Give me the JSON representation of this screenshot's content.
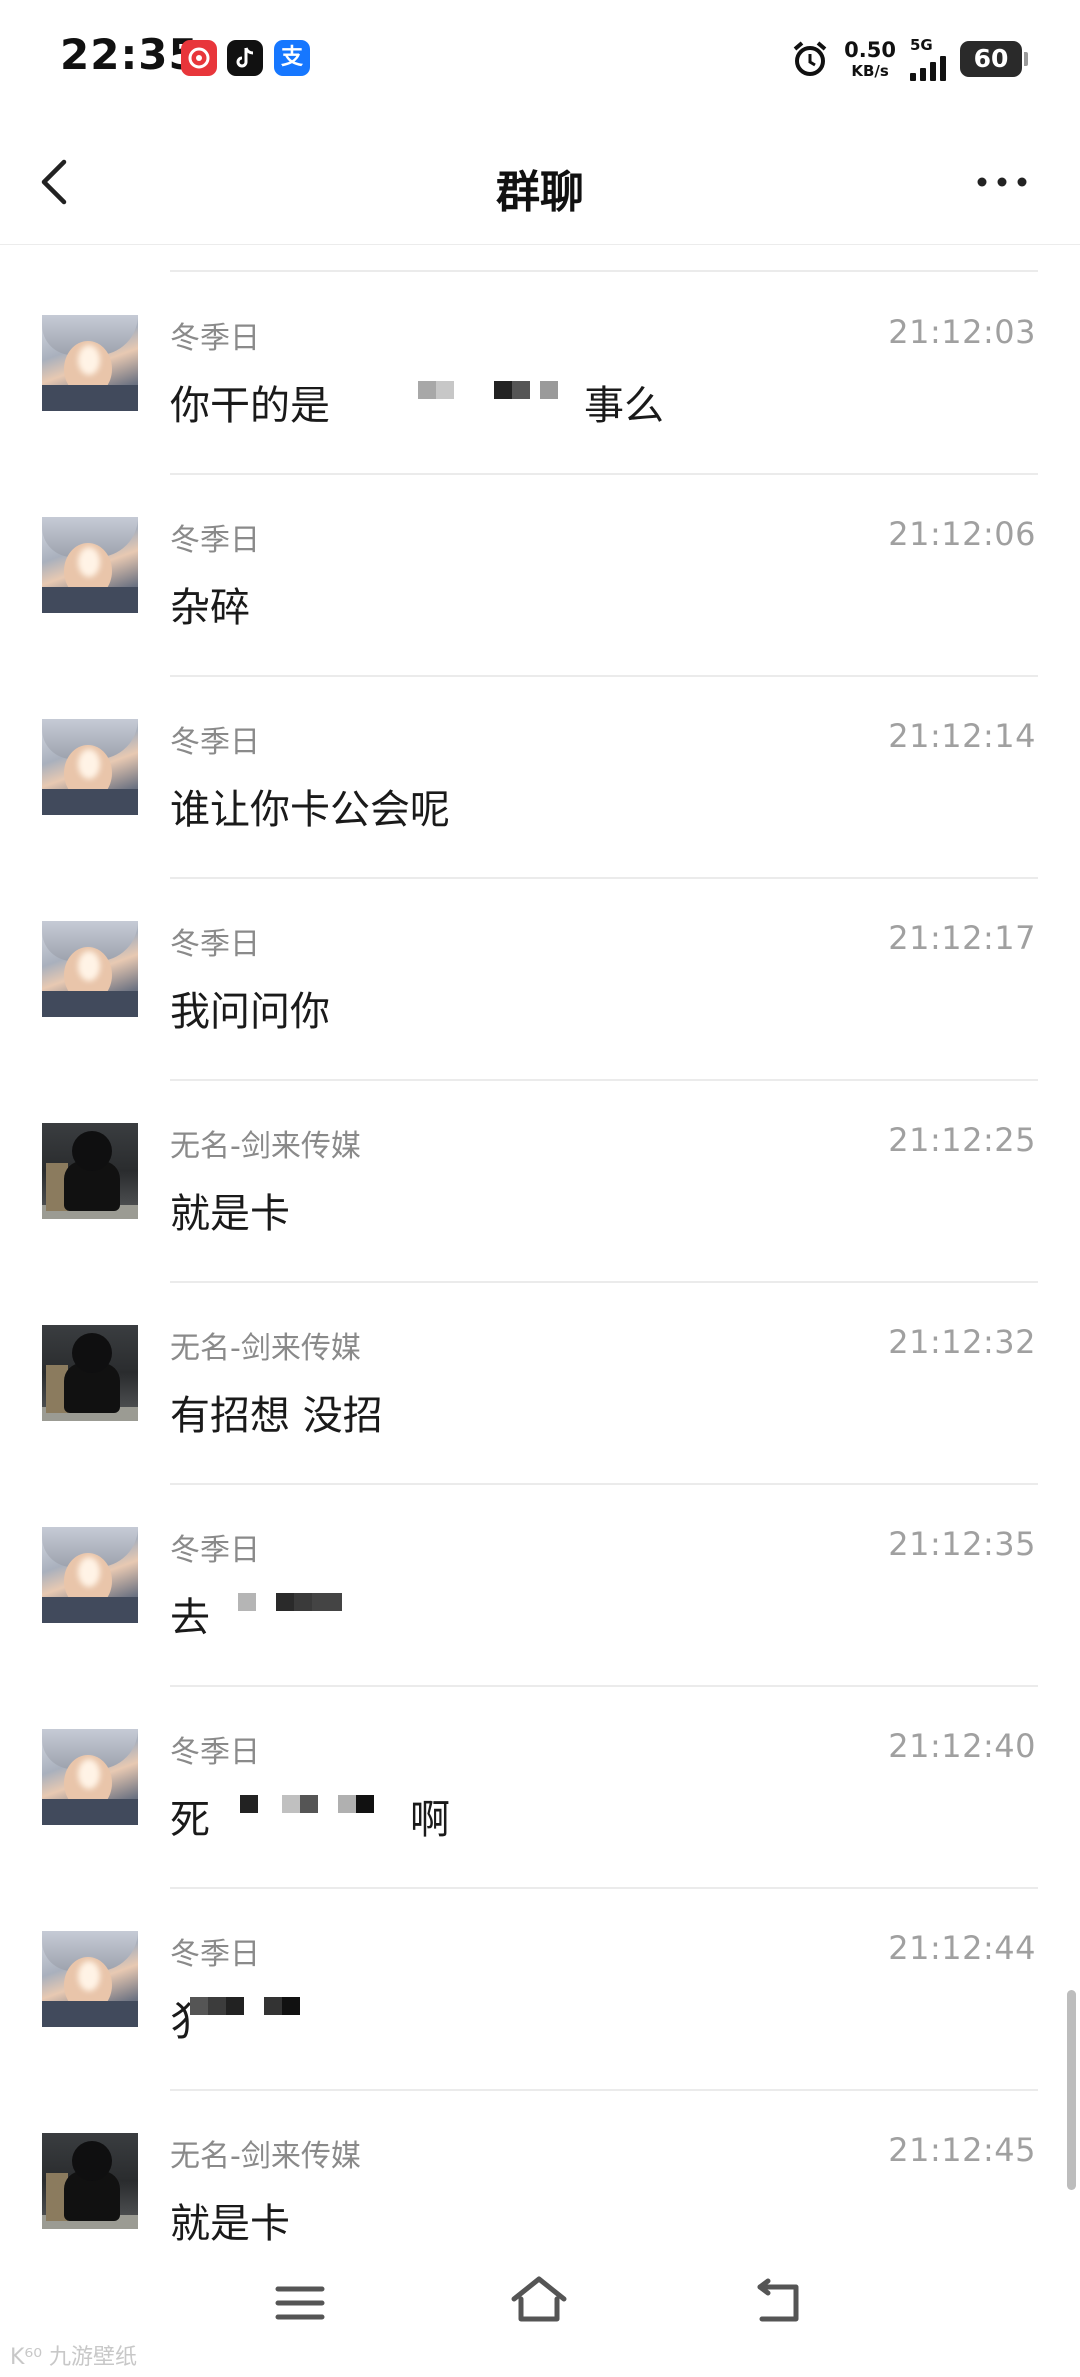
{
  "status_bar": {
    "time": "22:35",
    "app_icons": [
      "music-app-icon",
      "tiktok-icon",
      "alipay-icon"
    ],
    "alipay_glyph": "支",
    "net_speed_value": "0.50",
    "net_speed_unit": "KB/s",
    "network": "5G",
    "battery": "60"
  },
  "header": {
    "title": "群聊"
  },
  "messages": [
    {
      "sender": "冬季日",
      "time": "21:12:03",
      "text": "你干的是",
      "text_suffix": "事么"
    },
    {
      "sender": "冬季日",
      "time": "21:12:06",
      "text": "杂碎"
    },
    {
      "sender": "冬季日",
      "time": "21:12:14",
      "text": "谁让你卡公会呢"
    },
    {
      "sender": "冬季日",
      "time": "21:12:17",
      "text": "我问问你"
    },
    {
      "sender": "无名-剑来传媒",
      "time": "21:12:25",
      "text": "就是卡"
    },
    {
      "sender": "无名-剑来传媒",
      "time": "21:12:32",
      "text": "有招想  没招"
    },
    {
      "sender": "冬季日",
      "time": "21:12:35",
      "text": "去"
    },
    {
      "sender": "冬季日",
      "time": "21:12:40",
      "text": "死",
      "text_suffix": "啊"
    },
    {
      "sender": "冬季日",
      "time": "21:12:44",
      "text": "犭"
    },
    {
      "sender": "无名-剑来传媒",
      "time": "21:12:45",
      "text": "就是卡"
    }
  ],
  "colors": {
    "background": "#ffffff",
    "separator": "#ebebeb",
    "sender_text": "#8a8a8a",
    "time_text": "#a0a0a0",
    "message_text": "#1a1a1a"
  },
  "watermark": "K⁶⁰ 九游壁纸"
}
